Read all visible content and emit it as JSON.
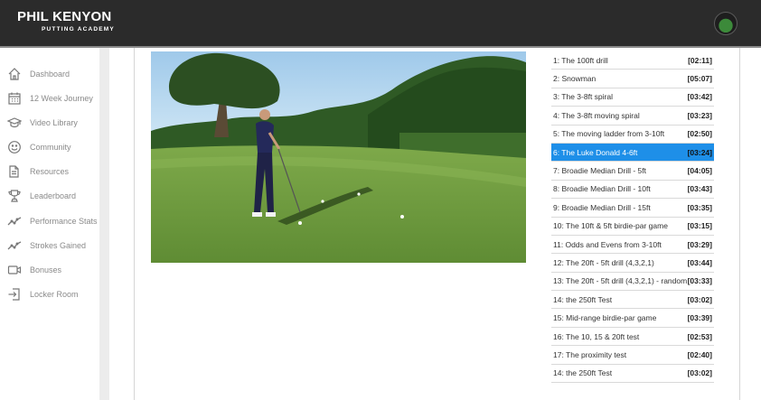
{
  "header": {
    "brand_name": "PHIL KENYON",
    "brand_sub": "PUTTING ACADEMY",
    "avatar_icon": "user-avatar"
  },
  "sidebar": {
    "items": [
      {
        "label": "Dashboard",
        "icon": "home-icon"
      },
      {
        "label": "12 Week Journey",
        "icon": "calendar-icon"
      },
      {
        "label": "Video Library",
        "icon": "graduation-cap-icon"
      },
      {
        "label": "Community",
        "icon": "smiley-icon"
      },
      {
        "label": "Resources",
        "icon": "documents-icon"
      },
      {
        "label": "Leaderboard",
        "icon": "trophy-icon"
      },
      {
        "label": "Performance Stats",
        "icon": "trend-line-icon"
      },
      {
        "label": "Strokes Gained",
        "icon": "trend-line-icon"
      },
      {
        "label": "Bonuses",
        "icon": "video-camera-icon"
      },
      {
        "label": "Locker Room",
        "icon": "sign-in-icon"
      }
    ]
  },
  "playlist": {
    "active_index": 5,
    "active_color": "#1e8fe8",
    "items": [
      {
        "title": "1: The 100ft drill",
        "duration": "[02:11]"
      },
      {
        "title": "2: Snowman",
        "duration": "[05:07]"
      },
      {
        "title": "3: The 3-8ft spiral",
        "duration": "[03:42]"
      },
      {
        "title": "4: The 3-8ft moving spiral",
        "duration": "[03:23]"
      },
      {
        "title": "5: The moving ladder from 3-10ft",
        "duration": "[02:50]"
      },
      {
        "title": "6: The Luke Donald 4-6ft",
        "duration": "[03:24]"
      },
      {
        "title": "7: Broadie Median Drill - 5ft",
        "duration": "[04:05]"
      },
      {
        "title": "8: Broadie Median Drill - 10ft",
        "duration": "[03:43]"
      },
      {
        "title": "9: Broadie Median Drill - 15ft",
        "duration": "[03:35]"
      },
      {
        "title": "10: The 10ft & 5ft birdie-par game",
        "duration": "[03:15]"
      },
      {
        "title": "11: Odds and Evens from 3-10ft",
        "duration": "[03:29]"
      },
      {
        "title": "12: The 20ft - 5ft drill (4,3,2,1)",
        "duration": "[03:44]"
      },
      {
        "title": "13: The 20ft - 5ft drill (4,3,2,1) - random",
        "duration": "[03:33]"
      },
      {
        "title": "14: the 250ft Test",
        "duration": "[03:02]"
      },
      {
        "title": "15: Mid-range birdie-par game",
        "duration": "[03:39]"
      },
      {
        "title": "16: The 10, 15 & 20ft test",
        "duration": "[02:53]"
      },
      {
        "title": "17: The proximity test",
        "duration": "[02:40]"
      },
      {
        "title": "14: the 250ft Test",
        "duration": "[03:02]"
      }
    ]
  }
}
